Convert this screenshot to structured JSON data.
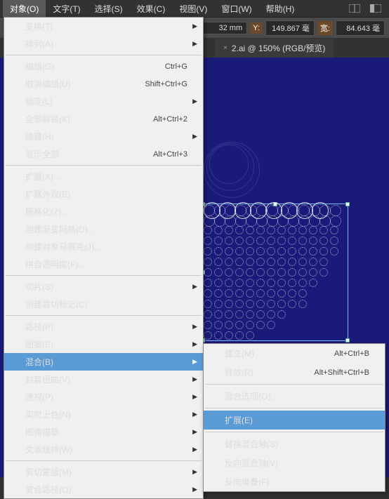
{
  "menubar": {
    "items": [
      "对象(O)",
      "文字(T)",
      "选择(S)",
      "效果(C)",
      "视图(V)",
      "窗口(W)",
      "帮助(H)"
    ]
  },
  "toolbar": {
    "x_unit": "32 mm",
    "y_label": "Y:",
    "y_value": "149.867 毫",
    "w_label": "宽:",
    "w_value": "84.643 毫"
  },
  "tab": {
    "close": "×",
    "label": "2.ai @ 150% (RGB/预览)"
  },
  "menu_object": {
    "groups": [
      [
        {
          "label": "变换(T)",
          "submenu": true
        },
        {
          "label": "排列(A)",
          "submenu": true
        }
      ],
      [
        {
          "label": "编组(G)",
          "shortcut": "Ctrl+G"
        },
        {
          "label": "取消编组(U)",
          "shortcut": "Shift+Ctrl+G"
        },
        {
          "label": "锁定(L)",
          "submenu": true
        },
        {
          "label": "全部解锁(K)",
          "shortcut": "Alt+Ctrl+2"
        },
        {
          "label": "隐藏(H)",
          "submenu": true
        },
        {
          "label": "显示全部",
          "shortcut": "Alt+Ctrl+3",
          "disabled": true
        }
      ],
      [
        {
          "label": "扩展(X)..."
        },
        {
          "label": "扩展外观(E)",
          "disabled": true
        },
        {
          "label": "栅格化(Z)..."
        },
        {
          "label": "创建渐变网格(D)..."
        },
        {
          "label": "创建对象马赛克(J)..."
        },
        {
          "label": "拼合透明度(F)..."
        }
      ],
      [
        {
          "label": "切片(S)",
          "submenu": true
        },
        {
          "label": "创建裁切标记(C)"
        }
      ],
      [
        {
          "label": "路径(P)",
          "submenu": true
        },
        {
          "label": "图案(E)",
          "submenu": true
        },
        {
          "label": "混合(B)",
          "submenu": true,
          "highlight": true
        },
        {
          "label": "封套扭曲(V)",
          "submenu": true
        },
        {
          "label": "透视(P)",
          "submenu": true
        },
        {
          "label": "实时上色(N)",
          "submenu": true
        },
        {
          "label": "图像描摹",
          "submenu": true
        },
        {
          "label": "文本绕排(W)",
          "submenu": true
        }
      ],
      [
        {
          "label": "剪切蒙版(M)",
          "submenu": true
        },
        {
          "label": "复合路径(O)",
          "submenu": true
        }
      ]
    ]
  },
  "submenu_blend": {
    "groups": [
      [
        {
          "label": "建立(M)",
          "shortcut": "Alt+Ctrl+B"
        },
        {
          "label": "释放(R)",
          "shortcut": "Alt+Shift+Ctrl+B"
        }
      ],
      [
        {
          "label": "混合选项(O)..."
        }
      ],
      [
        {
          "label": "扩展(E)",
          "highlight": true
        }
      ],
      [
        {
          "label": "替换混合轴(S)",
          "disabled": true
        },
        {
          "label": "反向混合轴(V)"
        },
        {
          "label": "反向堆叠(F)"
        }
      ]
    ]
  }
}
